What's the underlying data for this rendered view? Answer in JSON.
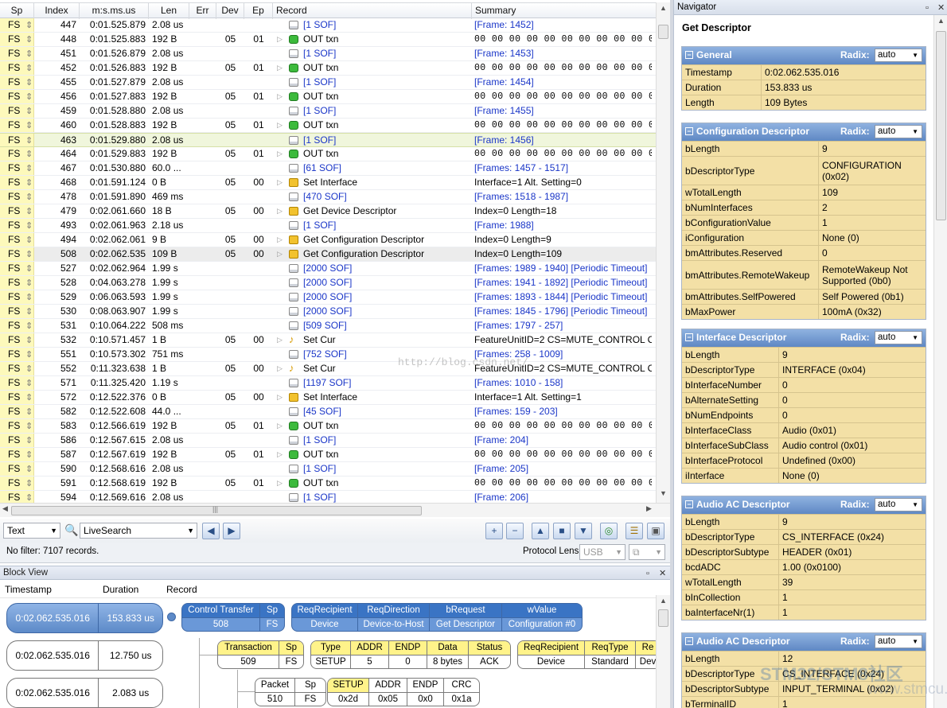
{
  "grid": {
    "headers": [
      "Sp",
      "Index",
      "m:s.ms.us",
      "Len",
      "Err",
      "Dev",
      "Ep",
      "Record",
      "Summary"
    ],
    "rows": [
      {
        "sp": "FS",
        "idx": "447",
        "ts": "0:01.525.879",
        "len": "2.08 us",
        "dev": "",
        "ep": "",
        "icon": "sof",
        "exp": false,
        "rec": "[1 SOF]",
        "sum": "[Frame: 1452]",
        "link": true,
        "hex": false,
        "style": ""
      },
      {
        "sp": "FS",
        "idx": "448",
        "ts": "0:01.525.883",
        "len": "192 B",
        "dev": "05",
        "ep": "01",
        "icon": "out",
        "exp": true,
        "rec": "OUT txn",
        "sum": "00 00 00 00 00 00 00 00 00 00 00 00",
        "link": false,
        "hex": true,
        "style": ""
      },
      {
        "sp": "FS",
        "idx": "451",
        "ts": "0:01.526.879",
        "len": "2.08 us",
        "dev": "",
        "ep": "",
        "icon": "sof",
        "exp": false,
        "rec": "[1 SOF]",
        "sum": "[Frame: 1453]",
        "link": true,
        "hex": false,
        "style": ""
      },
      {
        "sp": "FS",
        "idx": "452",
        "ts": "0:01.526.883",
        "len": "192 B",
        "dev": "05",
        "ep": "01",
        "icon": "out",
        "exp": true,
        "rec": "OUT txn",
        "sum": "00 00 00 00 00 00 00 00 00 00 00 00",
        "link": false,
        "hex": true,
        "style": ""
      },
      {
        "sp": "FS",
        "idx": "455",
        "ts": "0:01.527.879",
        "len": "2.08 us",
        "dev": "",
        "ep": "",
        "icon": "sof",
        "exp": false,
        "rec": "[1 SOF]",
        "sum": "[Frame: 1454]",
        "link": true,
        "hex": false,
        "style": ""
      },
      {
        "sp": "FS",
        "idx": "456",
        "ts": "0:01.527.883",
        "len": "192 B",
        "dev": "05",
        "ep": "01",
        "icon": "out",
        "exp": true,
        "rec": "OUT txn",
        "sum": "00 00 00 00 00 00 00 00 00 00 00 00",
        "link": false,
        "hex": true,
        "style": ""
      },
      {
        "sp": "FS",
        "idx": "459",
        "ts": "0:01.528.880",
        "len": "2.08 us",
        "dev": "",
        "ep": "",
        "icon": "sof",
        "exp": false,
        "rec": "[1 SOF]",
        "sum": "[Frame: 1455]",
        "link": true,
        "hex": false,
        "style": ""
      },
      {
        "sp": "FS",
        "idx": "460",
        "ts": "0:01.528.883",
        "len": "192 B",
        "dev": "05",
        "ep": "01",
        "icon": "out",
        "exp": true,
        "rec": "OUT txn",
        "sum": "00 00 00 00 00 00 00 00 00 00 00 00",
        "link": false,
        "hex": true,
        "style": ""
      },
      {
        "sp": "FS",
        "idx": "463",
        "ts": "0:01.529.880",
        "len": "2.08 us",
        "dev": "",
        "ep": "",
        "icon": "sof",
        "exp": false,
        "rec": "[1 SOF]",
        "sum": "[Frame: 1456]",
        "link": true,
        "hex": false,
        "style": "sel"
      },
      {
        "sp": "FS",
        "idx": "464",
        "ts": "0:01.529.883",
        "len": "192 B",
        "dev": "05",
        "ep": "01",
        "icon": "out",
        "exp": true,
        "rec": "OUT txn",
        "sum": "00 00 00 00 00 00 00 00 00 00 00 00",
        "link": false,
        "hex": true,
        "style": ""
      },
      {
        "sp": "FS",
        "idx": "467",
        "ts": "0:01.530.880",
        "len": "60.0 ...",
        "dev": "",
        "ep": "",
        "icon": "sof",
        "exp": false,
        "rec": "[61 SOF]",
        "sum": "[Frames: 1457 - 1517]",
        "link": true,
        "hex": false,
        "style": ""
      },
      {
        "sp": "FS",
        "idx": "468",
        "ts": "0:01.591.124",
        "len": "0 B",
        "dev": "05",
        "ep": "00",
        "icon": "cfg",
        "exp": true,
        "rec": "Set Interface",
        "sum": "Interface=1 Alt. Setting=0",
        "link": false,
        "hex": false,
        "style": ""
      },
      {
        "sp": "FS",
        "idx": "478",
        "ts": "0:01.591.890",
        "len": "469 ms",
        "dev": "",
        "ep": "",
        "icon": "sof",
        "exp": false,
        "rec": "[470 SOF]",
        "sum": "[Frames: 1518 - 1987]",
        "link": true,
        "hex": false,
        "style": ""
      },
      {
        "sp": "FS",
        "idx": "479",
        "ts": "0:02.061.660",
        "len": "18 B",
        "dev": "05",
        "ep": "00",
        "icon": "cfg",
        "exp": true,
        "rec": "Get Device Descriptor",
        "sum": "Index=0 Length=18",
        "link": false,
        "hex": false,
        "style": ""
      },
      {
        "sp": "FS",
        "idx": "493",
        "ts": "0:02.061.963",
        "len": "2.18 us",
        "dev": "",
        "ep": "",
        "icon": "sof",
        "exp": false,
        "rec": "[1 SOF]",
        "sum": "[Frame: 1988]",
        "link": true,
        "hex": false,
        "style": ""
      },
      {
        "sp": "FS",
        "idx": "494",
        "ts": "0:02.062.061",
        "len": "9 B",
        "dev": "05",
        "ep": "00",
        "icon": "cfg",
        "exp": true,
        "rec": "Get Configuration Descriptor",
        "sum": "Index=0 Length=9",
        "link": false,
        "hex": false,
        "style": ""
      },
      {
        "sp": "FS",
        "idx": "508",
        "ts": "0:02.062.535",
        "len": "109 B",
        "dev": "05",
        "ep": "00",
        "icon": "cfg",
        "exp": true,
        "rec": "Get Configuration Descriptor",
        "sum": "Index=0 Length=109",
        "link": false,
        "hex": false,
        "style": "gray"
      },
      {
        "sp": "FS",
        "idx": "527",
        "ts": "0:02.062.964",
        "len": "1.99 s",
        "dev": "",
        "ep": "",
        "icon": "sof",
        "exp": false,
        "rec": "[2000 SOF]",
        "sum": "[Frames: 1989 - 1940] [Periodic Timeout]",
        "link": true,
        "hex": false,
        "style": ""
      },
      {
        "sp": "FS",
        "idx": "528",
        "ts": "0:04.063.278",
        "len": "1.99 s",
        "dev": "",
        "ep": "",
        "icon": "sof",
        "exp": false,
        "rec": "[2000 SOF]",
        "sum": "[Frames: 1941 - 1892] [Periodic Timeout]",
        "link": true,
        "hex": false,
        "style": ""
      },
      {
        "sp": "FS",
        "idx": "529",
        "ts": "0:06.063.593",
        "len": "1.99 s",
        "dev": "",
        "ep": "",
        "icon": "sof",
        "exp": false,
        "rec": "[2000 SOF]",
        "sum": "[Frames: 1893 - 1844] [Periodic Timeout]",
        "link": true,
        "hex": false,
        "style": ""
      },
      {
        "sp": "FS",
        "idx": "530",
        "ts": "0:08.063.907",
        "len": "1.99 s",
        "dev": "",
        "ep": "",
        "icon": "sof",
        "exp": false,
        "rec": "[2000 SOF]",
        "sum": "[Frames: 1845 - 1796] [Periodic Timeout]",
        "link": true,
        "hex": false,
        "style": ""
      },
      {
        "sp": "FS",
        "idx": "531",
        "ts": "0:10.064.222",
        "len": "508 ms",
        "dev": "",
        "ep": "",
        "icon": "sof",
        "exp": false,
        "rec": "[509 SOF]",
        "sum": "[Frames: 1797 - 257]",
        "link": true,
        "hex": false,
        "style": ""
      },
      {
        "sp": "FS",
        "idx": "532",
        "ts": "0:10.571.457",
        "len": "1 B",
        "dev": "05",
        "ep": "00",
        "icon": "note",
        "exp": true,
        "rec": "Set Cur",
        "sum": "FeatureUnitID=2 CS=MUTE_CONTROL C",
        "link": false,
        "hex": false,
        "style": ""
      },
      {
        "sp": "FS",
        "idx": "551",
        "ts": "0:10.573.302",
        "len": "751 ms",
        "dev": "",
        "ep": "",
        "icon": "sof",
        "exp": false,
        "rec": "[752 SOF]",
        "sum": "[Frames: 258 - 1009]",
        "link": true,
        "hex": false,
        "style": ""
      },
      {
        "sp": "FS",
        "idx": "552",
        "ts": "0:11.323.638",
        "len": "1 B",
        "dev": "05",
        "ep": "00",
        "icon": "note",
        "exp": true,
        "rec": "Set Cur",
        "sum": "FeatureUnitID=2 CS=MUTE_CONTROL C",
        "link": false,
        "hex": false,
        "style": ""
      },
      {
        "sp": "FS",
        "idx": "571",
        "ts": "0:11.325.420",
        "len": "1.19 s",
        "dev": "",
        "ep": "",
        "icon": "sof",
        "exp": false,
        "rec": "[1197 SOF]",
        "sum": "[Frames: 1010 - 158]",
        "link": true,
        "hex": false,
        "style": ""
      },
      {
        "sp": "FS",
        "idx": "572",
        "ts": "0:12.522.376",
        "len": "0 B",
        "dev": "05",
        "ep": "00",
        "icon": "cfg",
        "exp": true,
        "rec": "Set Interface",
        "sum": "Interface=1 Alt. Setting=1",
        "link": false,
        "hex": false,
        "style": ""
      },
      {
        "sp": "FS",
        "idx": "582",
        "ts": "0:12.522.608",
        "len": "44.0 ...",
        "dev": "",
        "ep": "",
        "icon": "sof",
        "exp": false,
        "rec": "[45 SOF]",
        "sum": "[Frames: 159 - 203]",
        "link": true,
        "hex": false,
        "style": ""
      },
      {
        "sp": "FS",
        "idx": "583",
        "ts": "0:12.566.619",
        "len": "192 B",
        "dev": "05",
        "ep": "01",
        "icon": "out",
        "exp": true,
        "rec": "OUT txn",
        "sum": "00 00 00 00 00 00 00 00 00 00 00 00",
        "link": false,
        "hex": true,
        "style": ""
      },
      {
        "sp": "FS",
        "idx": "586",
        "ts": "0:12.567.615",
        "len": "2.08 us",
        "dev": "",
        "ep": "",
        "icon": "sof",
        "exp": false,
        "rec": "[1 SOF]",
        "sum": "[Frame: 204]",
        "link": true,
        "hex": false,
        "style": ""
      },
      {
        "sp": "FS",
        "idx": "587",
        "ts": "0:12.567.619",
        "len": "192 B",
        "dev": "05",
        "ep": "01",
        "icon": "out",
        "exp": true,
        "rec": "OUT txn",
        "sum": "00 00 00 00 00 00 00 00 00 00 00 00",
        "link": false,
        "hex": true,
        "style": ""
      },
      {
        "sp": "FS",
        "idx": "590",
        "ts": "0:12.568.616",
        "len": "2.08 us",
        "dev": "",
        "ep": "",
        "icon": "sof",
        "exp": false,
        "rec": "[1 SOF]",
        "sum": "[Frame: 205]",
        "link": true,
        "hex": false,
        "style": ""
      },
      {
        "sp": "FS",
        "idx": "591",
        "ts": "0:12.568.619",
        "len": "192 B",
        "dev": "05",
        "ep": "01",
        "icon": "out",
        "exp": true,
        "rec": "OUT txn",
        "sum": "00 00 00 00 00 00 00 00 00 00 00 00",
        "link": false,
        "hex": true,
        "style": ""
      },
      {
        "sp": "FS",
        "idx": "594",
        "ts": "0:12.569.616",
        "len": "2.08 us",
        "dev": "",
        "ep": "",
        "icon": "sof",
        "exp": false,
        "rec": "[1 SOF]",
        "sum": "[Frame: 206]",
        "link": true,
        "hex": false,
        "style": ""
      }
    ]
  },
  "toolbar": {
    "search_mode": "Text",
    "live_search": "LiveSearch",
    "status": "No filter: 7107 records.",
    "protocol_lens_label": "Protocol Lens:",
    "protocol_lens_value": "USB"
  },
  "watermark": "http://blog.csdn.net/",
  "block_view": {
    "title": "Block View",
    "headers": [
      "Timestamp",
      "Duration",
      "Record"
    ],
    "entries": [
      {
        "timestamp": "0:02.062.535.016",
        "duration": "153.833 us"
      },
      {
        "timestamp": "0:02.062.535.016",
        "duration": "12.750 us"
      },
      {
        "timestamp": "0:02.062.535.016",
        "duration": "2.083 us"
      }
    ],
    "control": {
      "headers": [
        "Control Transfer",
        "Sp"
      ],
      "values": [
        "508",
        "FS"
      ]
    },
    "request": {
      "headers": [
        "ReqRecipient",
        "ReqDirection",
        "bRequest",
        "wValue"
      ],
      "values": [
        "Device",
        "Device-to-Host",
        "Get Descriptor",
        "Configuration #0"
      ]
    },
    "transaction": {
      "headers": [
        "Transaction",
        "Sp"
      ],
      "values": [
        "509",
        "FS"
      ]
    },
    "setup": {
      "headers": [
        "Type",
        "ADDR",
        "ENDP",
        "Data",
        "Status"
      ],
      "values": [
        "SETUP",
        "5",
        "0",
        "8 bytes",
        "ACK"
      ]
    },
    "req2": {
      "headers": [
        "ReqRecipient",
        "ReqType",
        "Re"
      ],
      "values": [
        "Device",
        "Standard",
        "Dev"
      ]
    },
    "packet": {
      "headers": [
        "Packet",
        "Sp"
      ],
      "values": [
        "510",
        "FS"
      ]
    },
    "pid": {
      "headers": [
        "SETUP",
        "ADDR",
        "ENDP",
        "CRC"
      ],
      "values": [
        "0x2d",
        "0x05",
        "0x0",
        "0x1a"
      ]
    }
  },
  "navigator": {
    "panel_title": "Navigator",
    "title": "Get Descriptor",
    "radix_label": "Radix:",
    "radix_value": "auto",
    "sections": [
      {
        "name": "General",
        "props": [
          [
            "Timestamp",
            "0:02.062.535.016"
          ],
          [
            "Duration",
            "153.833 us"
          ],
          [
            "Length",
            "109 Bytes"
          ]
        ]
      },
      {
        "name": "Configuration Descriptor",
        "props": [
          [
            "bLength",
            "9"
          ],
          [
            "bDescriptorType",
            "CONFIGURATION (0x02)"
          ],
          [
            "wTotalLength",
            "109"
          ],
          [
            "bNumInterfaces",
            "2"
          ],
          [
            "bConfigurationValue",
            "1"
          ],
          [
            "iConfiguration",
            "None (0)"
          ],
          [
            "bmAttributes.Reserved",
            "0"
          ],
          [
            "bmAttributes.RemoteWakeup",
            "RemoteWakeup Not Supported (0b0)"
          ],
          [
            "bmAttributes.SelfPowered",
            "Self Powered (0b1)"
          ],
          [
            "bMaxPower",
            "100mA (0x32)"
          ]
        ]
      },
      {
        "name": "Interface Descriptor",
        "props": [
          [
            "bLength",
            "9"
          ],
          [
            "bDescriptorType",
            "INTERFACE (0x04)"
          ],
          [
            "bInterfaceNumber",
            "0"
          ],
          [
            "bAlternateSetting",
            "0"
          ],
          [
            "bNumEndpoints",
            "0"
          ],
          [
            "bInterfaceClass",
            "Audio (0x01)"
          ],
          [
            "bInterfaceSubClass",
            "Audio control (0x01)"
          ],
          [
            "bInterfaceProtocol",
            "Undefined (0x00)"
          ],
          [
            "iInterface",
            "None (0)"
          ]
        ]
      },
      {
        "name": "Audio AC Descriptor",
        "props": [
          [
            "bLength",
            "9"
          ],
          [
            "bDescriptorType",
            "CS_INTERFACE (0x24)"
          ],
          [
            "bDescriptorSubtype",
            "HEADER (0x01)"
          ],
          [
            "bcdADC",
            "1.00 (0x0100)"
          ],
          [
            "wTotalLength",
            "39"
          ],
          [
            "bInCollection",
            "1"
          ],
          [
            "baInterfaceNr(1)",
            "1"
          ]
        ]
      },
      {
        "name": "Audio AC Descriptor",
        "props": [
          [
            "bLength",
            "12"
          ],
          [
            "bDescriptorType",
            "CS_INTERFACE (0x24)"
          ],
          [
            "bDescriptorSubtype",
            "INPUT_TERMINAL (0x02)"
          ],
          [
            "bTerminalID",
            "1"
          ]
        ]
      }
    ]
  },
  "site_watermark": {
    "main": "STM32/STM8社区",
    "sub": "www.stmcu.org"
  }
}
